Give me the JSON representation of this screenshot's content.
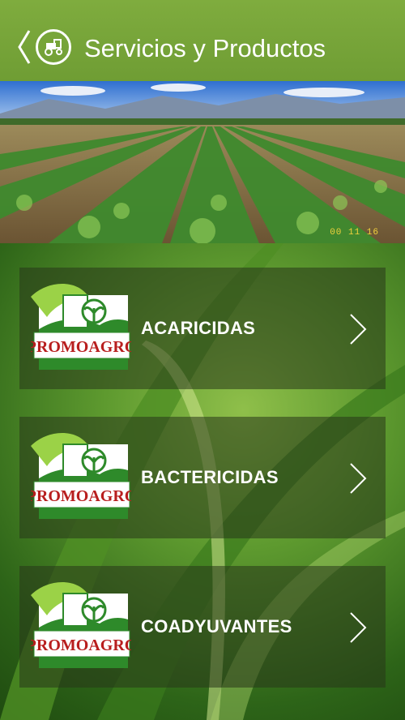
{
  "header": {
    "title": "Servicios y Productos",
    "icons": {
      "back": "chevron-left-icon",
      "app": "tractor-icon"
    },
    "color": "#6f9d34"
  },
  "banner": {
    "date_stamp": "00  11  16"
  },
  "list": {
    "items": [
      {
        "label": "ACARICIDAS",
        "logo_text": "PROMOAGRO"
      },
      {
        "label": "BACTERICIDAS",
        "logo_text": "PROMOAGRO"
      },
      {
        "label": "COADYUVANTES",
        "logo_text": "PROMOAGRO"
      }
    ]
  },
  "colors": {
    "logo_green": "#2e8a2a",
    "logo_red": "#b81e1e",
    "card_overlay": "rgba(40,55,25,0.55)"
  }
}
